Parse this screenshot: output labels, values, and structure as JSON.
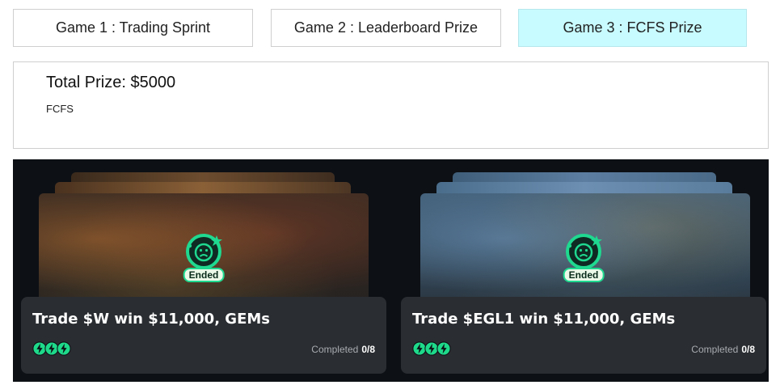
{
  "tabs": [
    {
      "label": "Game 1 : Trading Sprint",
      "active": false
    },
    {
      "label": "Game 2 : Leaderboard Prize",
      "active": false
    },
    {
      "label": "Game 3 : FCFS Prize",
      "active": true
    }
  ],
  "prize": {
    "title": "Total Prize: $5000",
    "subtitle": "FCFS"
  },
  "cards": [
    {
      "title": "Trade $W win $11,000, GEMs",
      "status": "Ended",
      "status_icon": "sad-face-icon",
      "coin_icons": [
        "bolt-coin-icon",
        "bolt-coin-icon",
        "bolt-coin-icon"
      ],
      "completed_label": "Completed",
      "completed_count": "0/8"
    },
    {
      "title": "Trade $EGL1 win $11,000, GEMs",
      "status": "Ended",
      "status_icon": "sad-face-icon",
      "coin_icons": [
        "bolt-coin-icon",
        "bolt-coin-icon",
        "bolt-coin-icon"
      ],
      "completed_label": "Completed",
      "completed_count": "0/8"
    }
  ],
  "colors": {
    "active_tab": "#c8fbff",
    "accent_green": "#1ed98f",
    "dark_panel": "#0d1116",
    "card_info": "#2a2d31"
  }
}
